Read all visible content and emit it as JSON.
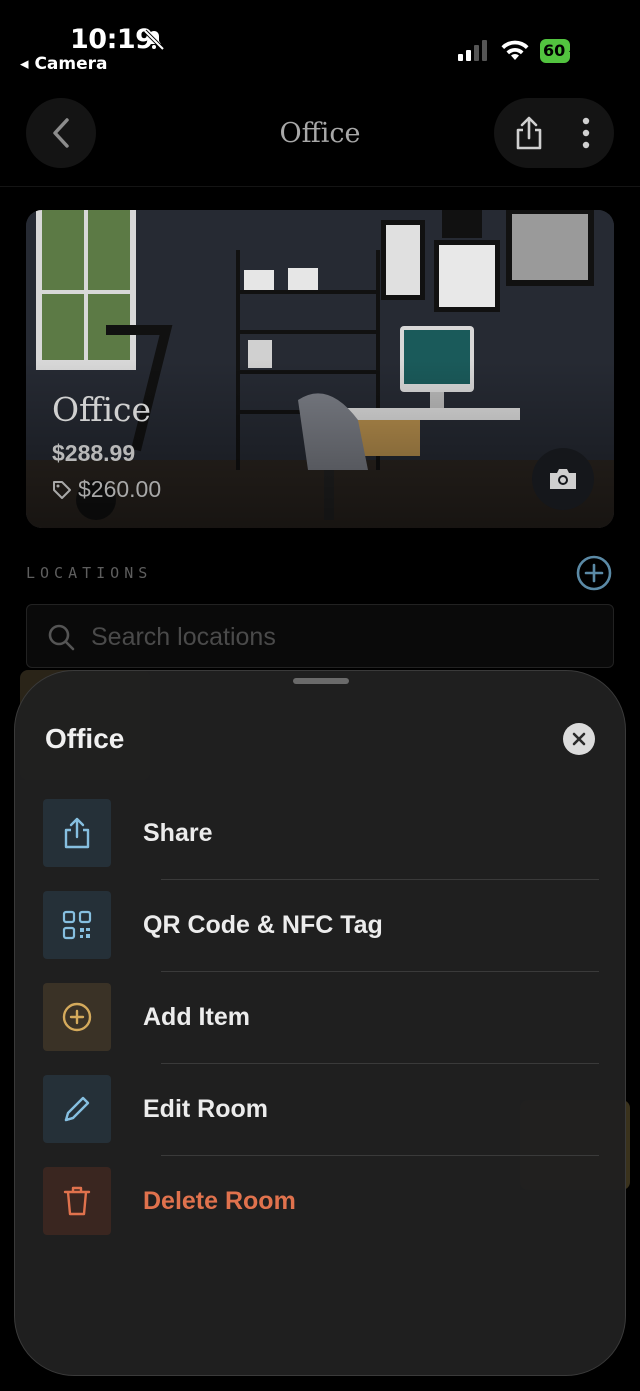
{
  "status_bar": {
    "time": "10:19",
    "back_app": "◂ Camera",
    "battery": "60"
  },
  "nav": {
    "title": "Office"
  },
  "hero": {
    "title": "Office",
    "price": "$288.99",
    "tag_price": "$260.00"
  },
  "locations": {
    "label": "LOCATIONS",
    "search_placeholder": "Search locations"
  },
  "sheet": {
    "title": "Office",
    "items": [
      {
        "label": "Share",
        "icon": "share-icon",
        "color": "#ececec"
      },
      {
        "label": "QR Code & NFC Tag",
        "icon": "qr-code-icon",
        "color": "#ececec"
      },
      {
        "label": "Add Item",
        "icon": "add-circle-icon",
        "color": "#ececec"
      },
      {
        "label": "Edit Room",
        "icon": "pencil-icon",
        "color": "#ececec"
      },
      {
        "label": "Delete Room",
        "icon": "trash-icon",
        "color": "#e0724d"
      }
    ]
  },
  "colors": {
    "accent_blue": "#7fb6d8",
    "accent_gold": "#c9a45c",
    "danger": "#e0724d",
    "battery_green": "#52c33f"
  }
}
